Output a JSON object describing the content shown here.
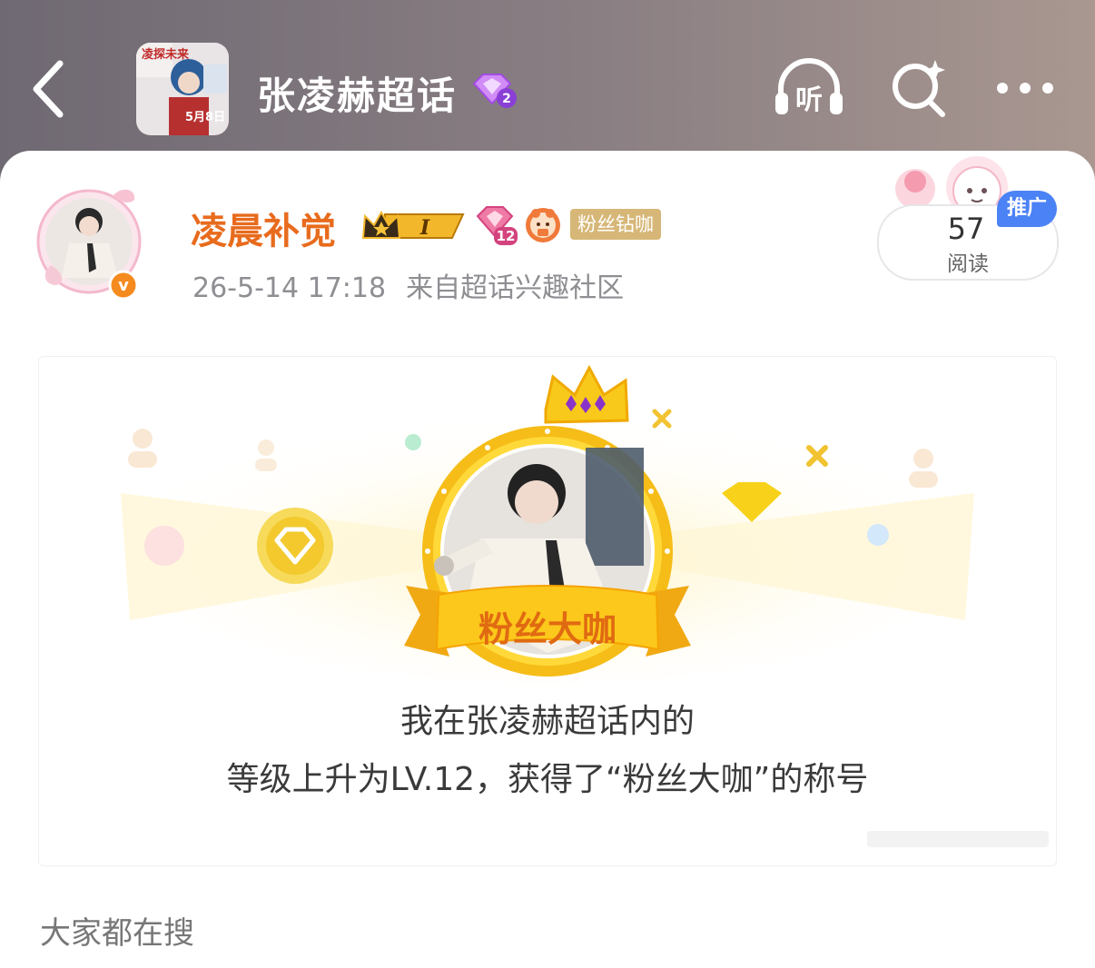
{
  "header": {
    "topic_title": "张凌赫超话",
    "topic_level": "2",
    "listen_label": "听",
    "thumb_text_top": "凌探未来",
    "thumb_date": "5月8日"
  },
  "post": {
    "author_name": "凌晨补觉",
    "crown_level": "I",
    "fan_level": "12",
    "fan_title_tag": "粉丝钻咖",
    "verified_mark": "v",
    "timestamp": "26-5-14 17:18",
    "source": "来自超话兴趣社区",
    "read_count": "57",
    "read_label": "阅读",
    "promo_label": "推广"
  },
  "share_card": {
    "ribbon_text": "粉丝大咖",
    "line1": "我在张凌赫超话内的",
    "line2": "等级上升为LV.12，获得了“粉丝大咖”的称号"
  },
  "section": {
    "search_heading": "大家都在搜"
  },
  "colors": {
    "author_orange": "#e86b1d",
    "fan_tag_gold": "#d7b778",
    "promo_blue": "#4b82f5",
    "badge_purple": "#b05cf0",
    "ribbon_gold": "#f5b700"
  }
}
